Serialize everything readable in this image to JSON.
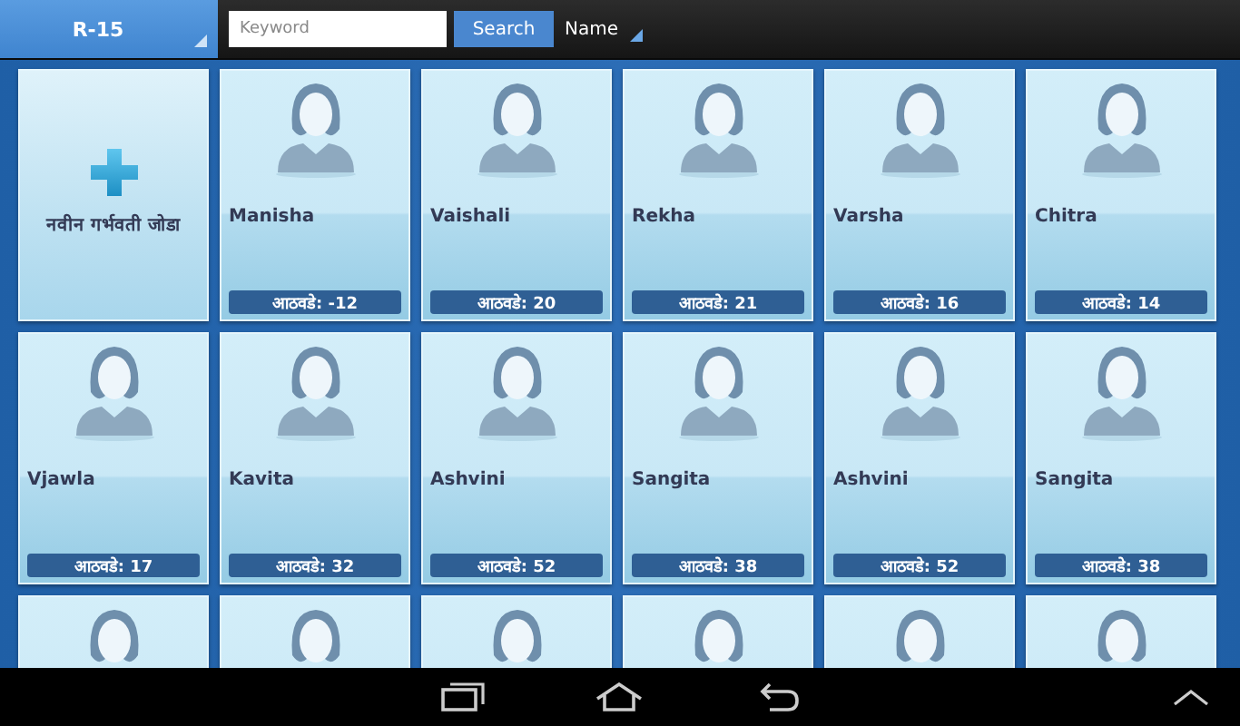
{
  "top_bar": {
    "village": "R-15",
    "search": {
      "placeholder": "Keyword",
      "button": "Search"
    },
    "sort": "Name"
  },
  "cards": [
    {
      "kind": "add",
      "label": "नवीन गर्भवती जोडा"
    },
    {
      "kind": "person",
      "name": "Manisha",
      "badge": "आठवडे: -12"
    },
    {
      "kind": "person",
      "name": "Vaishali",
      "badge": "आठवडे: 20"
    },
    {
      "kind": "person",
      "name": "Rekha",
      "badge": "आठवडे: 21"
    },
    {
      "kind": "person",
      "name": "Varsha",
      "badge": "आठवडे: 16"
    },
    {
      "kind": "person",
      "name": "Chitra",
      "badge": "आठवडे: 14"
    },
    {
      "kind": "person",
      "name": "Vjawla",
      "badge": "आठवडे: 17"
    },
    {
      "kind": "person",
      "name": "Kavita",
      "badge": "आठवडे: 32"
    },
    {
      "kind": "person",
      "name": "Ashvini",
      "badge": "आठवडे: 52"
    },
    {
      "kind": "person",
      "name": "Sangita",
      "badge": "आठवडे: 38"
    },
    {
      "kind": "person",
      "name": "Ashvini",
      "badge": "आठवडे: 52"
    },
    {
      "kind": "person",
      "name": "Sangita",
      "badge": "आठवडे: 38"
    },
    {
      "kind": "cut"
    },
    {
      "kind": "cut"
    },
    {
      "kind": "cut"
    },
    {
      "kind": "cut"
    },
    {
      "kind": "cut"
    },
    {
      "kind": "cut"
    }
  ]
}
